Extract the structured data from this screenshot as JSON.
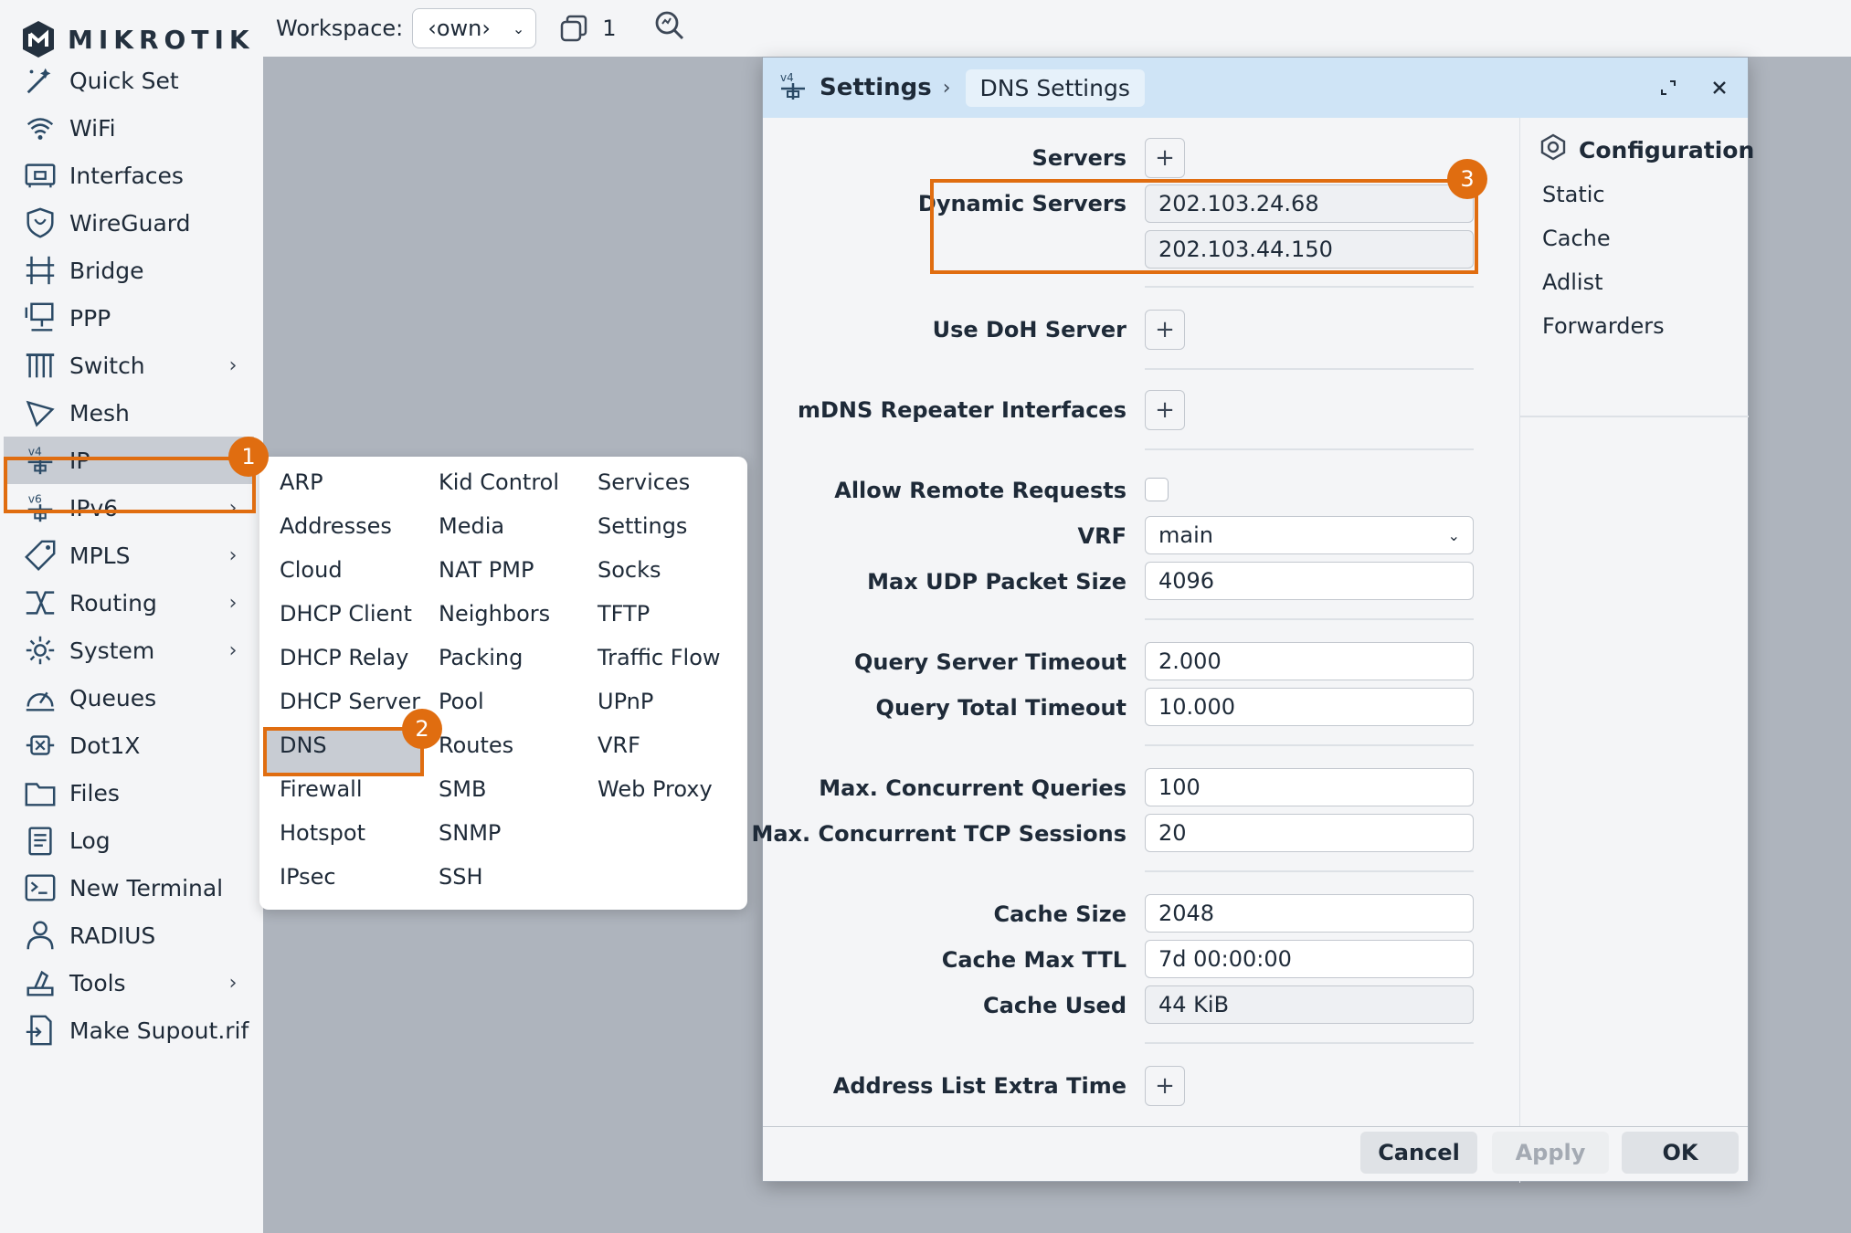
{
  "brand": {
    "name": "MIKROTIK"
  },
  "topbar": {
    "workspace_label": "Workspace:",
    "workspace_value": "‹own›",
    "window_count": "1"
  },
  "sidebar": {
    "items": [
      {
        "label": "Quick Set",
        "icon": "wand-icon",
        "has_submenu": false
      },
      {
        "label": "WiFi",
        "icon": "wifi-icon",
        "has_submenu": false
      },
      {
        "label": "Interfaces",
        "icon": "interfaces-icon",
        "has_submenu": false
      },
      {
        "label": "WireGuard",
        "icon": "shield-icon",
        "has_submenu": false
      },
      {
        "label": "Bridge",
        "icon": "bridge-icon",
        "has_submenu": false
      },
      {
        "label": "PPP",
        "icon": "ppp-icon",
        "has_submenu": false
      },
      {
        "label": "Switch",
        "icon": "switch-icon",
        "has_submenu": true
      },
      {
        "label": "Mesh",
        "icon": "mesh-icon",
        "has_submenu": false
      },
      {
        "label": "IP",
        "icon": "ipv4-icon",
        "has_submenu": true
      },
      {
        "label": "IPv6",
        "icon": "ipv6-icon",
        "has_submenu": true
      },
      {
        "label": "MPLS",
        "icon": "tag-icon",
        "has_submenu": true
      },
      {
        "label": "Routing",
        "icon": "routing-icon",
        "has_submenu": true
      },
      {
        "label": "System",
        "icon": "gear-icon",
        "has_submenu": true
      },
      {
        "label": "Queues",
        "icon": "gauge-icon",
        "has_submenu": false
      },
      {
        "label": "Dot1X",
        "icon": "dot1x-icon",
        "has_submenu": false
      },
      {
        "label": "Files",
        "icon": "folder-icon",
        "has_submenu": false
      },
      {
        "label": "Log",
        "icon": "log-icon",
        "has_submenu": false
      },
      {
        "label": "New Terminal",
        "icon": "terminal-icon",
        "has_submenu": false
      },
      {
        "label": "RADIUS",
        "icon": "radius-icon",
        "has_submenu": false
      },
      {
        "label": "Tools",
        "icon": "tools-icon",
        "has_submenu": true
      },
      {
        "label": "Make Supout.rif",
        "icon": "file-export-icon",
        "has_submenu": false
      }
    ]
  },
  "ip_menu": {
    "columns": [
      [
        "ARP",
        "Addresses",
        "Cloud",
        "DHCP Client",
        "DHCP Relay",
        "DHCP Server",
        "DNS",
        "Firewall",
        "Hotspot",
        "IPsec"
      ],
      [
        "Kid Control",
        "Media",
        "NAT PMP",
        "Neighbors",
        "Packing",
        "Pool",
        "Routes",
        "SMB",
        "SNMP",
        "SSH"
      ],
      [
        "Services",
        "Settings",
        "Socks",
        "TFTP",
        "Traffic Flow",
        "UPnP",
        "VRF",
        "Web Proxy"
      ]
    ]
  },
  "window": {
    "breadcrumb_main": "Settings",
    "breadcrumb_sub": "DNS Settings",
    "fields": {
      "servers_label": "Servers",
      "dynamic_servers_label": "Dynamic Servers",
      "dynamic_servers": [
        "202.103.24.68",
        "202.103.44.150"
      ],
      "use_doh_label": "Use DoH Server",
      "mdns_label": "mDNS Repeater Interfaces",
      "allow_remote_label": "Allow Remote Requests",
      "allow_remote_checked": false,
      "vrf_label": "VRF",
      "vrf_value": "main",
      "max_udp_label": "Max UDP Packet Size",
      "max_udp_value": "4096",
      "query_server_timeout_label": "Query Server Timeout",
      "query_server_timeout_value": "2.000",
      "query_total_timeout_label": "Query Total Timeout",
      "query_total_timeout_value": "10.000",
      "max_concurrent_queries_label": "Max. Concurrent Queries",
      "max_concurrent_queries_value": "100",
      "max_tcp_sessions_label": "Max. Concurrent TCP Sessions",
      "max_tcp_sessions_value": "20",
      "cache_size_label": "Cache Size",
      "cache_size_value": "2048",
      "cache_max_ttl_label": "Cache Max TTL",
      "cache_max_ttl_value": "7d 00:00:00",
      "cache_used_label": "Cache Used",
      "cache_used_value": "44 KiB",
      "address_list_extra_label": "Address List Extra Time"
    },
    "config_pane": {
      "title": "Configuration",
      "items": [
        "Static",
        "Cache",
        "Adlist",
        "Forwarders"
      ]
    },
    "footer": {
      "cancel": "Cancel",
      "apply": "Apply",
      "ok": "OK"
    }
  },
  "callouts": [
    "1",
    "2",
    "3"
  ],
  "colors": {
    "accent": "#e06d10",
    "header": "#cfe4f6",
    "sidebar": "#f4f5f7",
    "desktop": "#aeb4bd"
  }
}
